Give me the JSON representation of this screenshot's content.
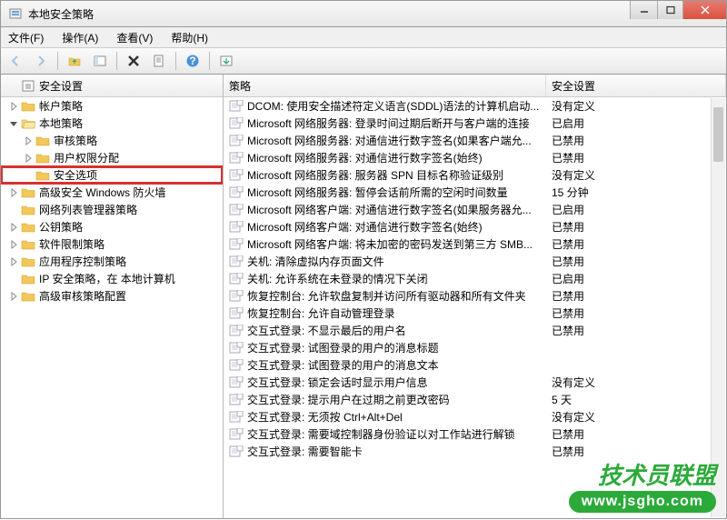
{
  "window": {
    "title": "本地安全策略"
  },
  "menu": {
    "file": "文件(F)",
    "action": "操作(A)",
    "view": "查看(V)",
    "help": "帮助(H)"
  },
  "tree_header": "安全设置",
  "tree": {
    "n0": "帐户策略",
    "n1": "本地策略",
    "n1_0": "审核策略",
    "n1_1": "用户权限分配",
    "n1_2": "安全选项",
    "n2": "高级安全 Windows 防火墙",
    "n3": "网络列表管理器策略",
    "n4": "公钥策略",
    "n5": "软件限制策略",
    "n6": "应用程序控制策略",
    "n7": "IP 安全策略，在 本地计算机",
    "n8": "高级审核策略配置"
  },
  "list_header": {
    "policy": "策略",
    "setting": "安全设置"
  },
  "policies": [
    {
      "name": "DCOM: 使用安全描述符定义语言(SDDL)语法的计算机启动...",
      "setting": "没有定义"
    },
    {
      "name": "Microsoft 网络服务器: 登录时间过期后断开与客户端的连接",
      "setting": "已启用"
    },
    {
      "name": "Microsoft 网络服务器: 对通信进行数字签名(如果客户端允...",
      "setting": "已禁用"
    },
    {
      "name": "Microsoft 网络服务器: 对通信进行数字签名(始终)",
      "setting": "已禁用"
    },
    {
      "name": "Microsoft 网络服务器: 服务器 SPN 目标名称验证级别",
      "setting": "没有定义"
    },
    {
      "name": "Microsoft 网络服务器: 暂停会话前所需的空闲时间数量",
      "setting": "15 分钟"
    },
    {
      "name": "Microsoft 网络客户端: 对通信进行数字签名(如果服务器允...",
      "setting": "已启用"
    },
    {
      "name": "Microsoft 网络客户端: 对通信进行数字签名(始终)",
      "setting": "已禁用"
    },
    {
      "name": "Microsoft 网络客户端: 将未加密的密码发送到第三方 SMB...",
      "setting": "已禁用"
    },
    {
      "name": "关机: 清除虚拟内存页面文件",
      "setting": "已禁用"
    },
    {
      "name": "关机: 允许系统在未登录的情况下关闭",
      "setting": "已启用"
    },
    {
      "name": "恢复控制台: 允许软盘复制并访问所有驱动器和所有文件夹",
      "setting": "已禁用"
    },
    {
      "name": "恢复控制台: 允许自动管理登录",
      "setting": "已禁用"
    },
    {
      "name": "交互式登录: 不显示最后的用户名",
      "setting": "已禁用"
    },
    {
      "name": "交互式登录: 试图登录的用户的消息标题",
      "setting": ""
    },
    {
      "name": "交互式登录: 试图登录的用户的消息文本",
      "setting": ""
    },
    {
      "name": "交互式登录: 锁定会话时显示用户信息",
      "setting": "没有定义"
    },
    {
      "name": "交互式登录: 提示用户在过期之前更改密码",
      "setting": "5 天"
    },
    {
      "name": "交互式登录: 无须按 Ctrl+Alt+Del",
      "setting": "没有定义"
    },
    {
      "name": "交互式登录: 需要域控制器身份验证以对工作站进行解锁",
      "setting": "已禁用"
    },
    {
      "name": "交互式登录: 需要智能卡",
      "setting": "已禁用"
    }
  ],
  "watermark": {
    "line1": "技术员联盟",
    "line2": "www.jsgho.com"
  }
}
